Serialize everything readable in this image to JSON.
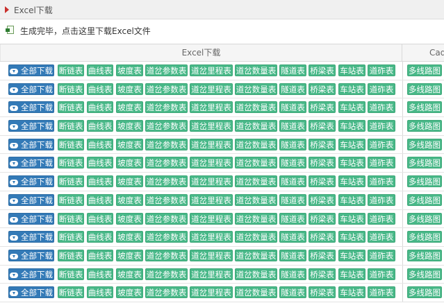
{
  "title_bar": {
    "title": "Excel下载"
  },
  "notice": {
    "text": "生成完毕，点击这里下载Excel文件"
  },
  "table": {
    "headers": {
      "excel": "Excel下载",
      "cad": "Cad下载"
    },
    "row_count": 13,
    "buttons": {
      "all": "全部下载",
      "break_chain": "断链表",
      "curve": "曲线表",
      "slope": "坡度表",
      "turnout_params": "道岔参数表",
      "turnout_mileage": "道岔里程表",
      "turnout_count": "道岔数量表",
      "tunnel": "隧道表",
      "bridge": "桥梁表",
      "station": "车站表",
      "hump": "道砟表",
      "multi_route": "多线路图"
    }
  },
  "colors": {
    "blue": "#337ab7",
    "green": "#48b888",
    "accent_red": "#c9302c"
  }
}
